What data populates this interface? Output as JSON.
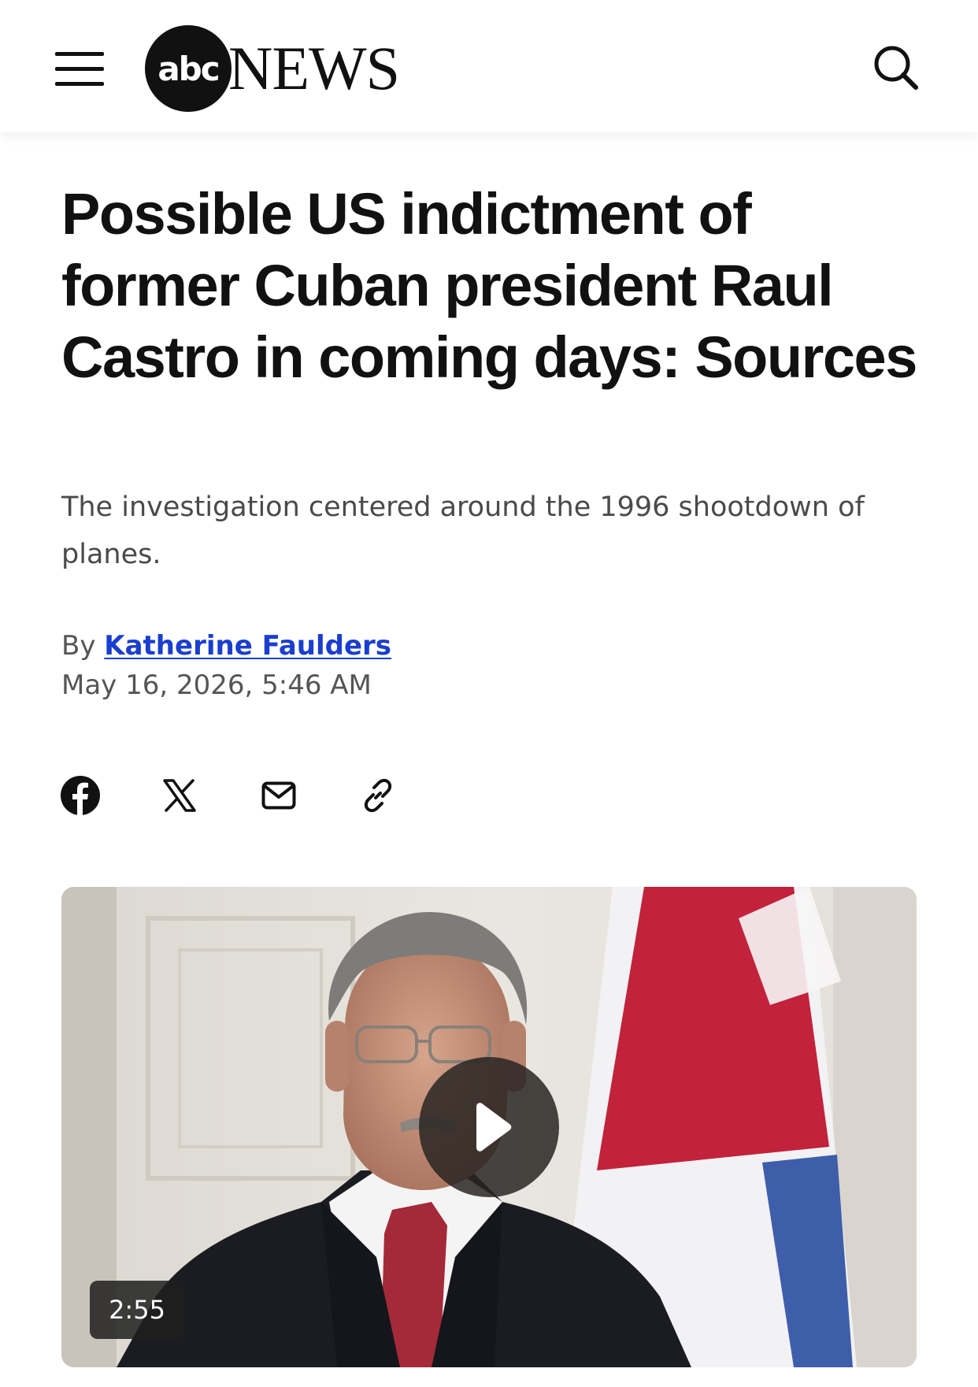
{
  "header": {
    "logo_mark": "abc",
    "logo_word": "NEWS",
    "menu_icon": "hamburger-menu-icon",
    "search_icon": "search-icon"
  },
  "article": {
    "headline": "Possible US indictment of former Cuban president Raul Castro in coming days: Sources",
    "subheadline": "The investigation centered around the 1996 shootdown of planes.",
    "byline_prefix": "By",
    "author": "Katherine Faulders",
    "published": "May 16, 2026, 5:46 AM"
  },
  "share": {
    "items": [
      {
        "name": "facebook",
        "icon": "facebook-icon"
      },
      {
        "name": "x",
        "icon": "x-icon"
      },
      {
        "name": "email",
        "icon": "mail-icon"
      },
      {
        "name": "copy-link",
        "icon": "link-icon"
      }
    ]
  },
  "video": {
    "duration": "2:55",
    "play_icon": "play-icon"
  },
  "colors": {
    "link": "#1a3ecf",
    "text": "#111111",
    "muted": "#555555"
  }
}
